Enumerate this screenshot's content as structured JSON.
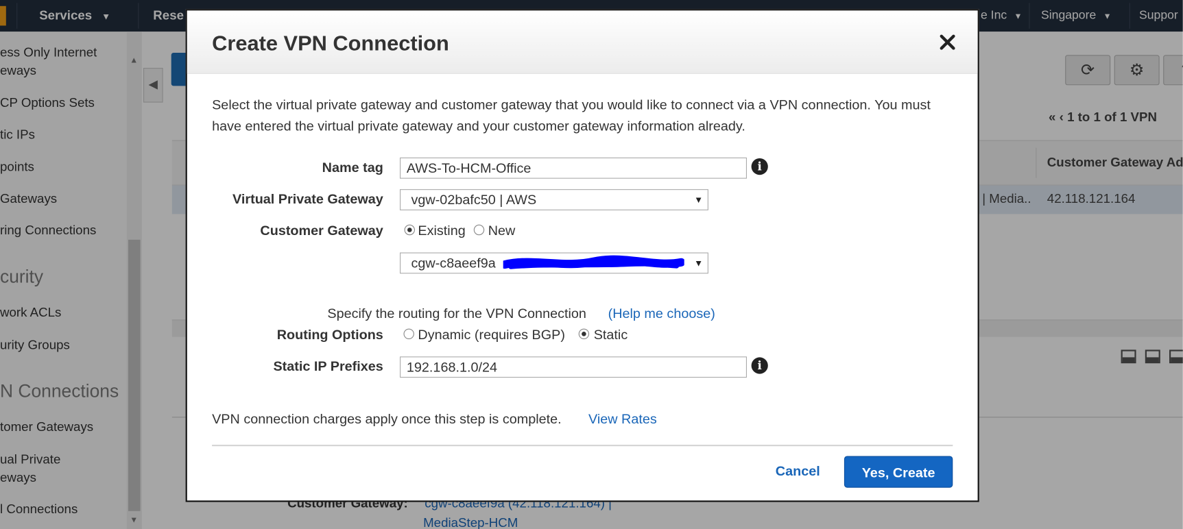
{
  "nav": {
    "services": "Services",
    "resource_groups_partial": "Rese",
    "account_partial": "e Inc",
    "region": "Singapore",
    "support_partial": "Suppor"
  },
  "sidebar": {
    "items": [
      "ess Only Internet",
      "eways",
      "CP Options Sets",
      "tic IPs",
      "points",
      " Gateways",
      "ring Connections",
      "curity",
      "work ACLs",
      "urity Groups",
      "N Connections",
      "tomer Gateways",
      "ual Private",
      "eways",
      "l Connections"
    ]
  },
  "background": {
    "pager_text": "1 to 1 of 1 VPN",
    "column_header": "Customer Gateway Ad",
    "row_partial": "| Media..",
    "row_ip": "42.118.121.164",
    "detail_label": "Customer Gateway:",
    "detail_link_1": "cgw-c8aeef9a (42.118.121.164) |",
    "detail_link_2": "MediaStep-HCM"
  },
  "modal": {
    "title": "Create VPN Connection",
    "intro": "Select the virtual private gateway and customer gateway that you would like to connect via a VPN connection. You must have entered the virtual private gateway and your customer gateway information already.",
    "name_tag_label": "Name tag",
    "name_tag_value": "AWS-To-HCM-Office",
    "vpg_label": "Virtual Private Gateway",
    "vpg_value": "vgw-02bafc50 | AWS",
    "cgw_label": "Customer Gateway",
    "cgw_existing": "Existing",
    "cgw_new": "New",
    "cgw_select_value": "cgw-c8aeef9a",
    "routing_intro": "Specify the routing for the VPN Connection",
    "help_link": "(Help me choose)",
    "routing_label": "Routing Options",
    "routing_dynamic": "Dynamic (requires BGP)",
    "routing_static": "Static",
    "prefix_label": "Static IP Prefixes",
    "prefix_value": "192.168.1.0/24",
    "charges_text": "VPN connection charges apply once this step is complete.",
    "view_rates": "View Rates",
    "cancel": "Cancel",
    "create": "Yes, Create"
  },
  "colors": {
    "nav_bg": "#232f3e",
    "primary": "#1466c2",
    "link": "#1a66b8",
    "redaction": "#0000ff"
  },
  "icons": {
    "close": "close-icon",
    "info": "info-icon",
    "refresh": "refresh-icon",
    "settings": "gear-icon",
    "help": "help-icon",
    "caret": "chevron-down-icon"
  }
}
